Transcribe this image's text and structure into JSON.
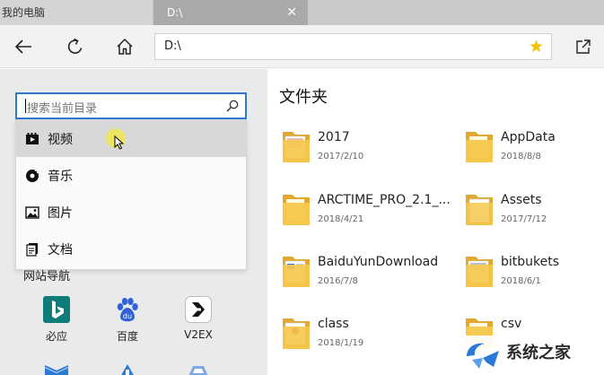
{
  "tabs": [
    {
      "label": "我的电脑",
      "active": false
    },
    {
      "label": "D:\\",
      "active": true
    }
  ],
  "tab_close_symbol": "✕",
  "toolbar": {
    "back_icon": "arrow-left-icon",
    "refresh_icon": "refresh-icon",
    "home_icon": "home-icon",
    "address": "D:\\",
    "favorite_icon": "star-icon",
    "favorite_symbol": "★",
    "share_icon": "share-icon"
  },
  "search": {
    "placeholder": "搜索当前目录",
    "icon": "search-icon"
  },
  "dropdown": [
    {
      "label": "视频",
      "icon": "video-icon",
      "active": true
    },
    {
      "label": "音乐",
      "icon": "music-icon",
      "active": false
    },
    {
      "label": "图片",
      "icon": "image-icon",
      "active": false
    },
    {
      "label": "文档",
      "icon": "document-icon",
      "active": false
    }
  ],
  "nav": {
    "title": "网站导航",
    "sites": [
      {
        "label": "必应",
        "icon": "bing-icon"
      },
      {
        "label": "百度",
        "icon": "baidu-icon"
      },
      {
        "label": "V2EX",
        "icon": "v2ex-icon"
      }
    ]
  },
  "folders_title": "文件夹",
  "folders": [
    {
      "name": "2017",
      "date": "2017/2/10"
    },
    {
      "name": "AppData",
      "date": "2018/8/8"
    },
    {
      "name": "ARCTIME_PRO_2.1_...",
      "date": "2018/4/21"
    },
    {
      "name": "Assets",
      "date": "2017/7/12"
    },
    {
      "name": "BaiduYunDownload",
      "date": "2016/7/8"
    },
    {
      "name": "bitbukets",
      "date": "2018/6/1"
    },
    {
      "name": "class",
      "date": "2018/1/19"
    },
    {
      "name": "csv",
      "date": ""
    }
  ],
  "watermark": {
    "text": "系统之家"
  },
  "colors": {
    "accent": "#2d7ad0",
    "folder": "#f5c84c",
    "folder_dark": "#e0a92e",
    "star": "#f0c000"
  }
}
